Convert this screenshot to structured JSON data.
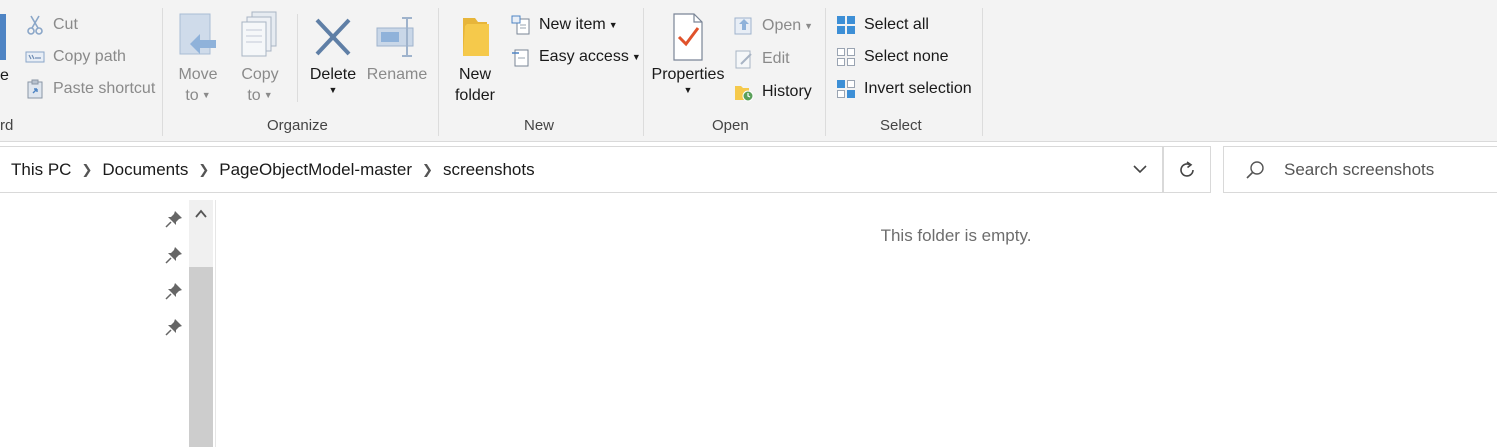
{
  "ribbon": {
    "clipboard": {
      "group_label": "rd",
      "partial_left_label": "e",
      "cut": "Cut",
      "copy_path": "Copy path",
      "paste_shortcut": "Paste shortcut"
    },
    "organize": {
      "group_label": "Organize",
      "move_to": [
        "Move",
        "to"
      ],
      "copy_to": [
        "Copy",
        "to"
      ],
      "delete": "Delete",
      "rename": "Rename"
    },
    "new": {
      "group_label": "New",
      "new_folder": [
        "New",
        "folder"
      ],
      "new_item": "New item",
      "easy_access": "Easy access"
    },
    "open": {
      "group_label": "Open",
      "properties": "Properties",
      "open": "Open",
      "edit": "Edit",
      "history": "History"
    },
    "select": {
      "group_label": "Select",
      "select_all": "Select all",
      "select_none": "Select none",
      "invert_selection": "Invert selection"
    }
  },
  "address": {
    "breadcrumbs": [
      "This PC",
      "Documents",
      "PageObjectModel-master",
      "screenshots"
    ]
  },
  "search": {
    "placeholder": "Search screenshots"
  },
  "content": {
    "empty_message": "This folder is empty."
  },
  "colors": {
    "ribbon_bg": "#f3f3f3",
    "accent_blue": "#3d8fd6",
    "delete_x": "#5f7fa6",
    "folder_yellow": "#f5c94b",
    "check_orange": "#e0522b"
  }
}
